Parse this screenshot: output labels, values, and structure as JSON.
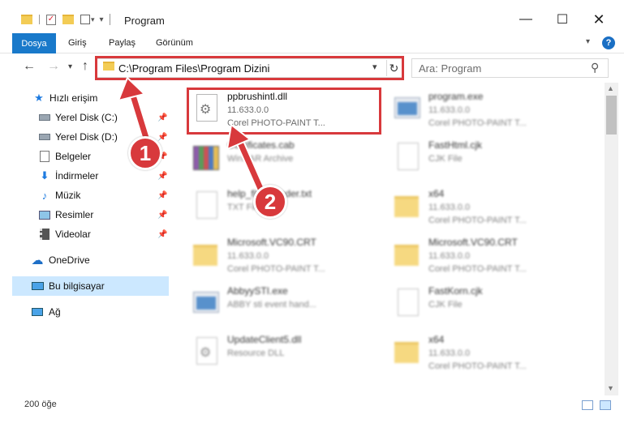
{
  "window": {
    "title": "Program",
    "minimize_icon": "minimize-icon",
    "maximize_icon": "maximize-icon",
    "close_icon": "close-icon"
  },
  "ribbon": {
    "file_tab": "Dosya",
    "tabs": [
      "Giriş",
      "Paylaş",
      "Görünüm"
    ]
  },
  "address": {
    "path": "C:\\Program Files\\Program Dizini"
  },
  "search": {
    "placeholder": "Ara: Program"
  },
  "sidebar": {
    "quick_access": "Hızlı erişim",
    "items": [
      {
        "label": "Yerel Disk (C:)",
        "icon": "drive-icon",
        "pinned": true
      },
      {
        "label": "Yerel Disk (D:)",
        "icon": "drive-icon",
        "pinned": true
      },
      {
        "label": "Belgeler",
        "icon": "documents-icon",
        "pinned": true
      },
      {
        "label": "İndirmeler",
        "icon": "downloads-icon",
        "pinned": true
      },
      {
        "label": "Müzik",
        "icon": "music-icon",
        "pinned": true
      },
      {
        "label": "Resimler",
        "icon": "pictures-icon",
        "pinned": true
      },
      {
        "label": "Videolar",
        "icon": "videos-icon",
        "pinned": true
      }
    ],
    "onedrive": "OneDrive",
    "this_pc": "Bu bilgisayar",
    "network": "Ağ"
  },
  "files": {
    "left": [
      {
        "name": "ppbrushintl.dll",
        "line2": "11.633.0.0",
        "line3": "Corel PHOTO-PAINT T...",
        "icon": "dll-gear-icon"
      },
      {
        "name": "Certificates.cab",
        "line2": "WinRAR Archive",
        "line3": "",
        "icon": "winrar-archive-icon"
      },
      {
        "name": "help_file_header.txt",
        "line2": "TXT File",
        "line3": "",
        "icon": "text-file-icon"
      },
      {
        "name": "Microsoft.VC90.CRT",
        "line2": "11.633.0.0",
        "line3": "Corel PHOTO-PAINT T...",
        "icon": "folder-icon"
      },
      {
        "name": "AbbyySTI.exe",
        "line2": "ABBY sti event hand...",
        "line3": "",
        "icon": "exe-icon"
      },
      {
        "name": "UpdateClient5.dll",
        "line2": "Resource DLL",
        "line3": "",
        "icon": "dll-gear-icon"
      }
    ],
    "right": [
      {
        "name": "program.exe",
        "line2": "11.633.0.0",
        "line3": "Corel PHOTO-PAINT T...",
        "icon": "exe-icon"
      },
      {
        "name": "FastHtml.cjk",
        "line2": "CJK File",
        "line3": "",
        "icon": "blank-file-icon"
      },
      {
        "name": "x64",
        "line2": "11.633.0.0",
        "line3": "Corel PHOTO-PAINT T...",
        "icon": "folder-icon"
      },
      {
        "name": "Microsoft.VC90.CRT",
        "line2": "11.633.0.0",
        "line3": "Corel PHOTO-PAINT T...",
        "icon": "folder-icon"
      },
      {
        "name": "FastKorn.cjk",
        "line2": "CJK File",
        "line3": "",
        "icon": "blank-file-icon"
      },
      {
        "name": "x64",
        "line2": "11.633.0.0",
        "line3": "Corel PHOTO-PAINT T...",
        "icon": "folder-icon"
      }
    ]
  },
  "status": {
    "item_count": "200 öğe"
  },
  "annotations": {
    "step1": "1",
    "step2": "2",
    "color": "#d8393c"
  }
}
